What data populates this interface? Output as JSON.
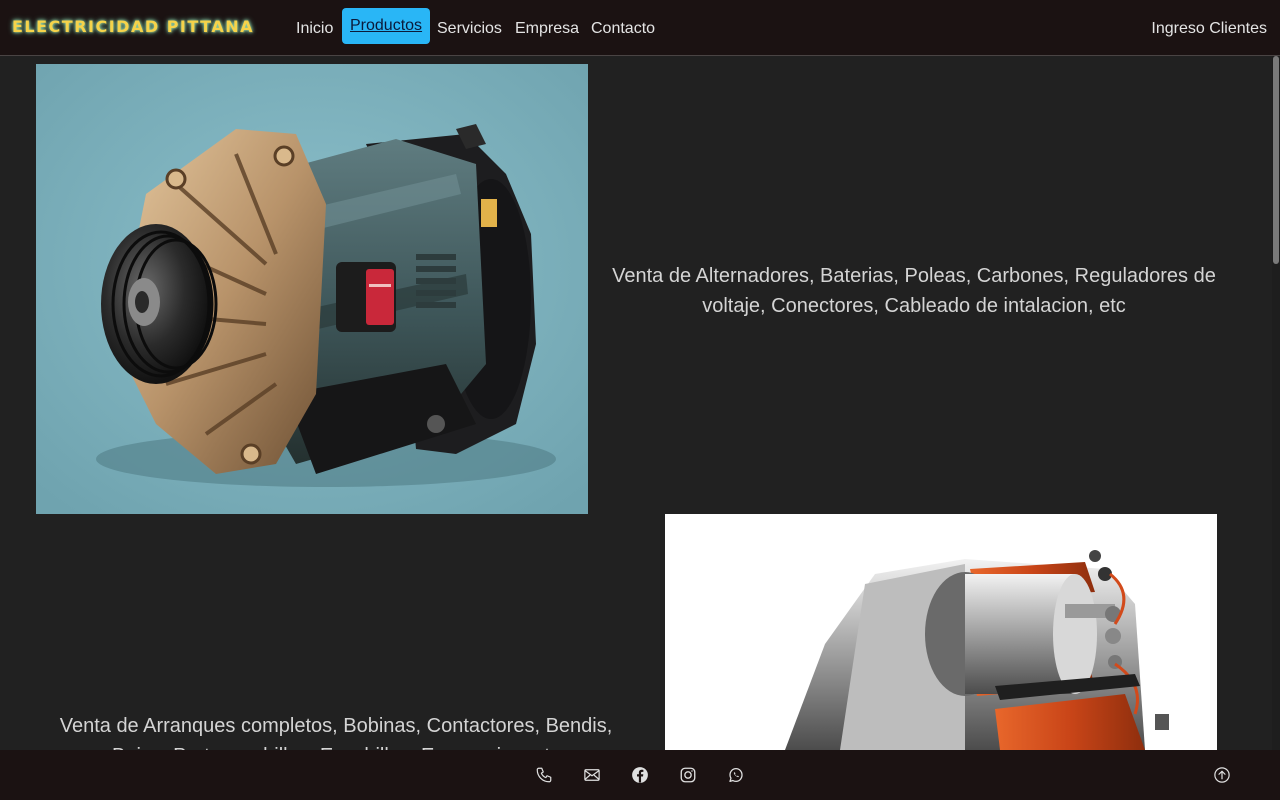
{
  "navbar": {
    "brand": "ELECTRICIDAD PITTANA",
    "links": [
      {
        "label": "Inicio"
      },
      {
        "label": "Productos",
        "active": true
      },
      {
        "label": "Servicios"
      },
      {
        "label": "Empresa"
      },
      {
        "label": "Contacto"
      }
    ],
    "login": "Ingreso Clientes"
  },
  "products": [
    {
      "text": "Venta de Alternadores, Baterias, Poleas, Carbones, Reguladores de voltaje, Conectores, Cableado de intalacion, etc",
      "image": "alternator-illustration"
    },
    {
      "text": "Venta de Arranques completos, Bobinas, Contactores, Bendis, Bujes, Portaescobillas, Escobillas, Engranajes, etc",
      "image": "starter-motor-cutaway"
    }
  ],
  "footer": {
    "icons": [
      "phone-icon",
      "mail-icon",
      "facebook-icon",
      "instagram-icon",
      "whatsapp-icon"
    ],
    "scroll_top_icon": "arrow-up-circle-icon"
  },
  "colors": {
    "background": "#212121",
    "navbar": "#1b1212",
    "active_link": "#29b6f6",
    "brand": "#f6d34a"
  }
}
